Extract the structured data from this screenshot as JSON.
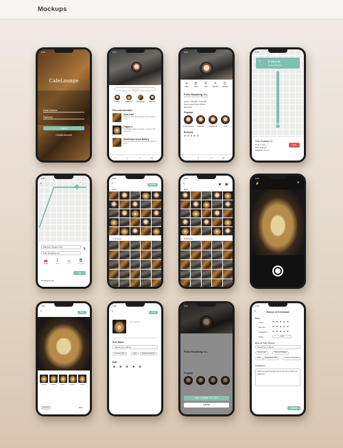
{
  "page": {
    "title": "Mockups"
  },
  "status_time": "9:41",
  "login": {
    "logo": "CafeLounge",
    "email_placeholder": "Email Address",
    "password_placeholder": "Password",
    "login_button": "Log In",
    "create_account": "Create Account"
  },
  "home": {
    "search_placeholder": "Search",
    "categories": [
      "Coffee",
      "Bakery",
      "Breakfast",
      "Brunch"
    ],
    "recommended_title": "Recommended",
    "items": [
      {
        "name": "Zeca Café",
        "desc": "Delicious Pancakes topped with seasonal fruits"
      },
      {
        "name": "Flipper's",
        "desc": "Surprisingly fluffy pancakes, a must-try for everyone"
      },
      {
        "name": "Dominique Ansel Bakery",
        "desc": "The croissants are the best baked goods in town"
      }
    ]
  },
  "detail": {
    "name": "Felix Roasting Co.",
    "address": "450 Park Ave South, New York",
    "hours": "Hours: 7:00 AM – 6:00 PM",
    "hours_link": "Open now",
    "desc": "Neue Laurel Fairly Street",
    "more": "More Info",
    "actions": [
      "Map",
      "Menu",
      "Call",
      "Review",
      "Update"
    ],
    "popular_title": "Popular",
    "popular": [
      "S'mores Latte",
      "Espresso",
      "Cappuccino",
      "Latte"
    ],
    "reviews_title": "Reviews"
  },
  "nav": {
    "street": "E 23rd St",
    "subtitle": "toward Park Ave",
    "place": "Felix Roasting Co.",
    "time": "Time: 3 min",
    "eta": "ETA: 2:41 pm",
    "distance": "Distance: 0.3 mi",
    "end": "End"
  },
  "route": {
    "from": "Madison Square Park",
    "to": "Felix Roasting Co.",
    "modes": [
      "Drive",
      "Walk",
      "Bike",
      "Transit"
    ],
    "go": "Go",
    "directions_list": "Directions List"
  },
  "gallery": {
    "eats": "Eats",
    "ambience": "Ambience",
    "upload": "Upload"
  },
  "camera": {
    "close": "×"
  },
  "photo_pick": {
    "next": "Next",
    "cancel": "Cancel",
    "edit": "Edit",
    "thumb_labels": [
      "Filter A",
      "Filter B",
      "Filter C",
      "Filter D",
      "Filter E"
    ]
  },
  "add_dish": {
    "description_placeholder": "Description...",
    "post": "Post",
    "dish_name_label": "Dish Name",
    "dish_select": "Search From Menu",
    "tags": [
      "S'mores Latte",
      "Latte",
      "Matcha Croissant"
    ],
    "rate_label": "Rate"
  },
  "call_sheet": {
    "call": "Call +1 (646) 727-7277",
    "cancel": "Cancel",
    "name": "Felix Roasting Co."
  },
  "review": {
    "title": "House of Croissant",
    "rate_label": "Rate",
    "rows": [
      "Food",
      "Service",
      "Ambience",
      "Noise"
    ],
    "noise_value": "Loud",
    "dish_label": "Dish of Your Choice",
    "dish_select": "Search From Menu",
    "tags": [
      "Classic Latte",
      "Matcha Croissant",
      "Latte",
      "Honeycomb Latte",
      "Coconut Cold Brew"
    ],
    "comment_label": "Comment",
    "comment": "This is a great hangout spot! S'mores Latte is a must-try!",
    "submit": "Submit"
  },
  "colors": {
    "accent": "#7fbfb0",
    "background": "#e7dccf"
  }
}
